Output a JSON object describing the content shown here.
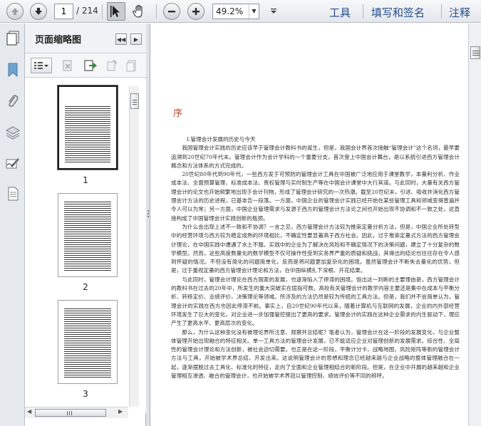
{
  "toolbar": {
    "page_current": "1",
    "page_total": "/ 214",
    "zoom": "49.2%",
    "links": {
      "tools": "工具",
      "sign": "填写和签名",
      "comment": "注释"
    }
  },
  "panel": {
    "title": "页面缩略图",
    "thumbnails": [
      {
        "label": "1"
      },
      {
        "label": "2"
      },
      {
        "label": "3"
      }
    ]
  },
  "document": {
    "heading": "序",
    "section": "I.管理会计发展的历史与今天",
    "paragraphs": [
      "我国管理会计实践的历史应该早于管理会计教科书的诞生，但是，我国会计界首次接触“管理会计”这个名词，最早要追溯到20世纪70年代末。管理会计作为会计学科的一个重要分支，首次登上中国会计舞台，是以系统引进西方管理会计概念和方法体系的方式完成的。",
      "20世纪80年代到90年代，一些西方发于可预防的管理会计工具在中国被广泛地应用于课堂教学，本量利分析、作业成本法、全面预算管理、标准成本法、责权管理与实时制生产等在中国会计课堂中大行其道。与此同时，大量有关西方管理会计的论文也开始频繁地出现于会计刊物，形成了管理会计研究的一次热潮。截至20世纪末，引进、吸收并消化西方管理会计方法的历史进程，已基本告一段落。一方面，中国企业的管理会计实践已经开始在某些管理工具和领域变得普遍并令人可以为常；另一方面，中国企业管理需求与发源于西方的管理会计方法论之间也开始出现不协调和不一致之处，这直接构成了中国管理会计实践创新的瓶颈。",
      "为什么会出现上述不一致和不协调？一言之见，西方管理会计方法较为推崇定量分析方法，但是，中国企业所处转型中的经营环境与西方较为稳定成熟的环境相比，不确定性要显著高于西方社会。因此，过于推崇定量式方法的西方管理会计理论，在中国实践中遭遇了水土不服。实践中的企业为了解决在风险和不确定情况下的决策问题，建立了十分复杂的数学模型。然而，这些高度数量化的数学模型不仅可操作性受到实务界严重的质疑和挑战，其得出的结论也往往存在令人感到怀疑的情况。不但没有简化的问题简单化，反而是将问题更加复杂化的困境。虽然管理会计不断失去量化的优势，但是，过于重视定量的西方管理会计理论和方法，在中国纵横扎下深根、开花结果。",
      "与此同时，管理会计理论在西方国家的发展，也逐渐陷入了停滞的困境。饱出这一判断的主要理由是，西方管理会计的教科书在过去的20年中，所发生的重大突破实在屈指可数。高校有关管理会计的教学内容主要还是集中在成本与平衡分析、转移定价、业绩评价、决策理论等领域。所涉及的方法仍然是较为传统的工具方法。但是，我们并不会简单认为，管理会计的实践在西方也因此停滞不前。事实上，自20世纪90年代以来，随着计算机与互联网的发展，企业的内外部经营环境发生了巨大的变化，对企业进一步加强管控提出了更高的要求。管理会计的实践在这种企业需求的内生驱动下，理应产生了更高水平、更高层次的变化。",
      "那么，为什么这种变化没有被理论界所注意、观察并总结呢？笔者认为，管理会计在这一阶段的发展变化，与企业整体管理开始出现融合的特征相关。单一工具方法的管理会计发展，已不能适应企业对管理创新的发展需求。综合性、全局性的管理会计理论和方法创新，被社会迫切需要。也正是在这一阶段，平衡计分卡、战略地图、风险矩阵等新的管理会计方法与工具，开始被学术界总结、开发出来。这说明管理会计的思想和理念已经越来越与企业战略的整体管理融合在一起，逐渐摆脱过去工具化、标准化的特征，走向了全面和企业管理相结合的新阶段。但是，在企业中开展的越来越和企业管理相互渗透、融合的管理会计，也开始被学术界冠以管理控制、绩效评价等不同的称呼。"
    ]
  }
}
